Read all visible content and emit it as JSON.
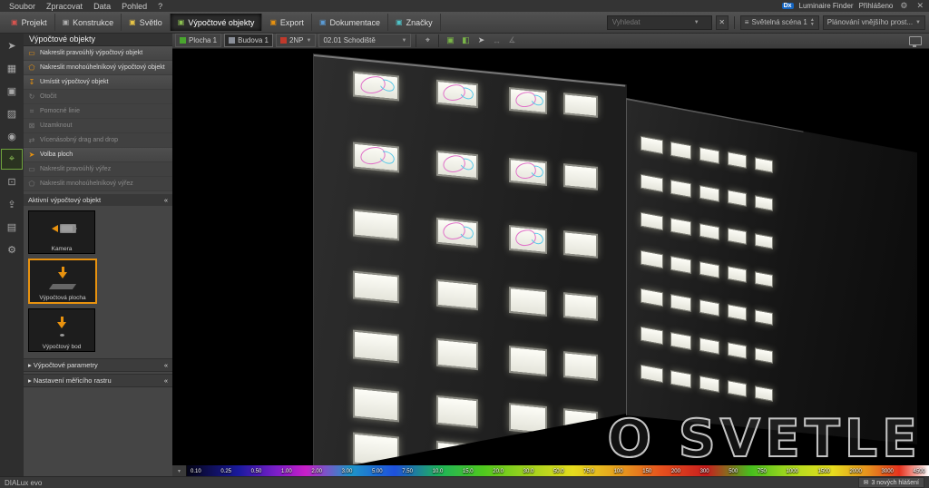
{
  "menu_bar": {
    "items": [
      "Soubor",
      "Zpracovat",
      "Data",
      "Pohled",
      "?"
    ],
    "right": {
      "dx_badge": "Dx",
      "luminaire_finder": "Luminaire Finder",
      "login_status": "Přihlášeno"
    }
  },
  "toolbar": {
    "tabs": [
      {
        "label": "Projekt",
        "icon": "project-icon",
        "color": "#d9544f",
        "active": false
      },
      {
        "label": "Konstrukce",
        "icon": "construction-icon",
        "color": "#b0b0b0",
        "active": false
      },
      {
        "label": "Světlo",
        "icon": "light-icon",
        "color": "#e8c547",
        "active": false
      },
      {
        "label": "Výpočtové objekty",
        "icon": "calculation-objects-icon",
        "color": "#8cc152",
        "active": true
      },
      {
        "label": "Export",
        "icon": "export-icon",
        "color": "#e8920f",
        "active": false
      },
      {
        "label": "Dokumentace",
        "icon": "documentation-icon",
        "color": "#5b9bd5",
        "active": false
      },
      {
        "label": "Značky",
        "icon": "tags-icon",
        "color": "#4fc3c8",
        "active": false
      }
    ],
    "search": {
      "placeholder": "Vyhledat"
    },
    "light_scene": "Světelná scéna 1",
    "planning_mode": "Plánování vnějšího prost..."
  },
  "left_strip": {
    "icons": [
      {
        "name": "select-tool-icon",
        "glyph": "➤",
        "active": false
      },
      {
        "name": "construction-mode-icon",
        "glyph": "▦",
        "active": false
      },
      {
        "name": "furniture-mode-icon",
        "glyph": "▣",
        "active": false
      },
      {
        "name": "materials-mode-icon",
        "glyph": "▨",
        "active": false
      },
      {
        "name": "light-mode-icon",
        "glyph": "◉",
        "active": false
      },
      {
        "name": "calculation-mode-icon",
        "glyph": "⌖",
        "active": true
      },
      {
        "name": "view-mode-icon",
        "glyph": "⊡",
        "active": false
      },
      {
        "name": "export-mode-icon",
        "glyph": "⇪",
        "active": false
      },
      {
        "name": "documentation-mode-icon",
        "glyph": "▤",
        "active": false
      },
      {
        "name": "settings-mode-icon",
        "glyph": "⚙",
        "active": false
      }
    ]
  },
  "sidebar": {
    "title": "Výpočtové objekty",
    "tools": [
      {
        "label": "Nakreslit pravoúhlý výpočtový objekt",
        "icon": "draw-rect-icon",
        "glyph": "▭",
        "enabled": true
      },
      {
        "label": "Nakreslit mnohoúhelníkový výpočtový objekt",
        "icon": "draw-polygon-icon",
        "glyph": "⬠",
        "enabled": true
      },
      {
        "label": "Umístit výpočtový objekt",
        "icon": "place-object-icon",
        "glyph": "↧",
        "enabled": true
      },
      {
        "label": "Otočit",
        "icon": "rotate-icon",
        "glyph": "↻",
        "enabled": false
      },
      {
        "label": "Pomocné linie",
        "icon": "help-lines-icon",
        "glyph": "⌗",
        "enabled": false
      },
      {
        "label": "Uzamknout",
        "icon": "lock-icon",
        "glyph": "⊠",
        "enabled": false
      },
      {
        "label": "Vícenásobný drag and drop",
        "icon": "multi-dragdrop-icon",
        "glyph": "⇄",
        "enabled": false
      },
      {
        "label": "Volba ploch",
        "icon": "select-surfaces-icon",
        "glyph": "➤",
        "enabled": true
      },
      {
        "label": "Nakreslit pravoúhlý výřez",
        "icon": "cut-rect-icon",
        "glyph": "▭",
        "enabled": false
      },
      {
        "label": "Nakreslit mnohoúhelníkový výřez",
        "icon": "cut-polygon-icon",
        "glyph": "⬠",
        "enabled": false
      }
    ],
    "active_section": "Aktivní výpočtový objekt",
    "objects": [
      {
        "label": "Kamera",
        "icon": "camera",
        "selected": false
      },
      {
        "label": "Výpočtová plocha",
        "icon": "calc-surface",
        "selected": true
      },
      {
        "label": "Výpočtový bod",
        "icon": "calc-point",
        "selected": false
      }
    ],
    "collapsed_sections": [
      "Výpočtové parametry",
      "Nastavení měřicího rastru"
    ]
  },
  "viewport": {
    "toolbar": {
      "surface": "Plocha 1",
      "building": "Budova 1",
      "floor": "2NP",
      "room": "02.01 Schodiště"
    },
    "watermark": "O SVETLE"
  },
  "false_color_scale": {
    "values": [
      "0.10",
      "0.25",
      "0.50",
      "1.00",
      "2.00",
      "3.00",
      "5.00",
      "7.50",
      "10.0",
      "15.0",
      "20.0",
      "30.0",
      "50.0",
      "75.0",
      "100",
      "150",
      "200",
      "300",
      "500",
      "750",
      "1000",
      "1500",
      "2000",
      "3000",
      "4500"
    ]
  },
  "status_bar": {
    "app": "DIALux evo",
    "notifications": "3 nových hlášení"
  }
}
